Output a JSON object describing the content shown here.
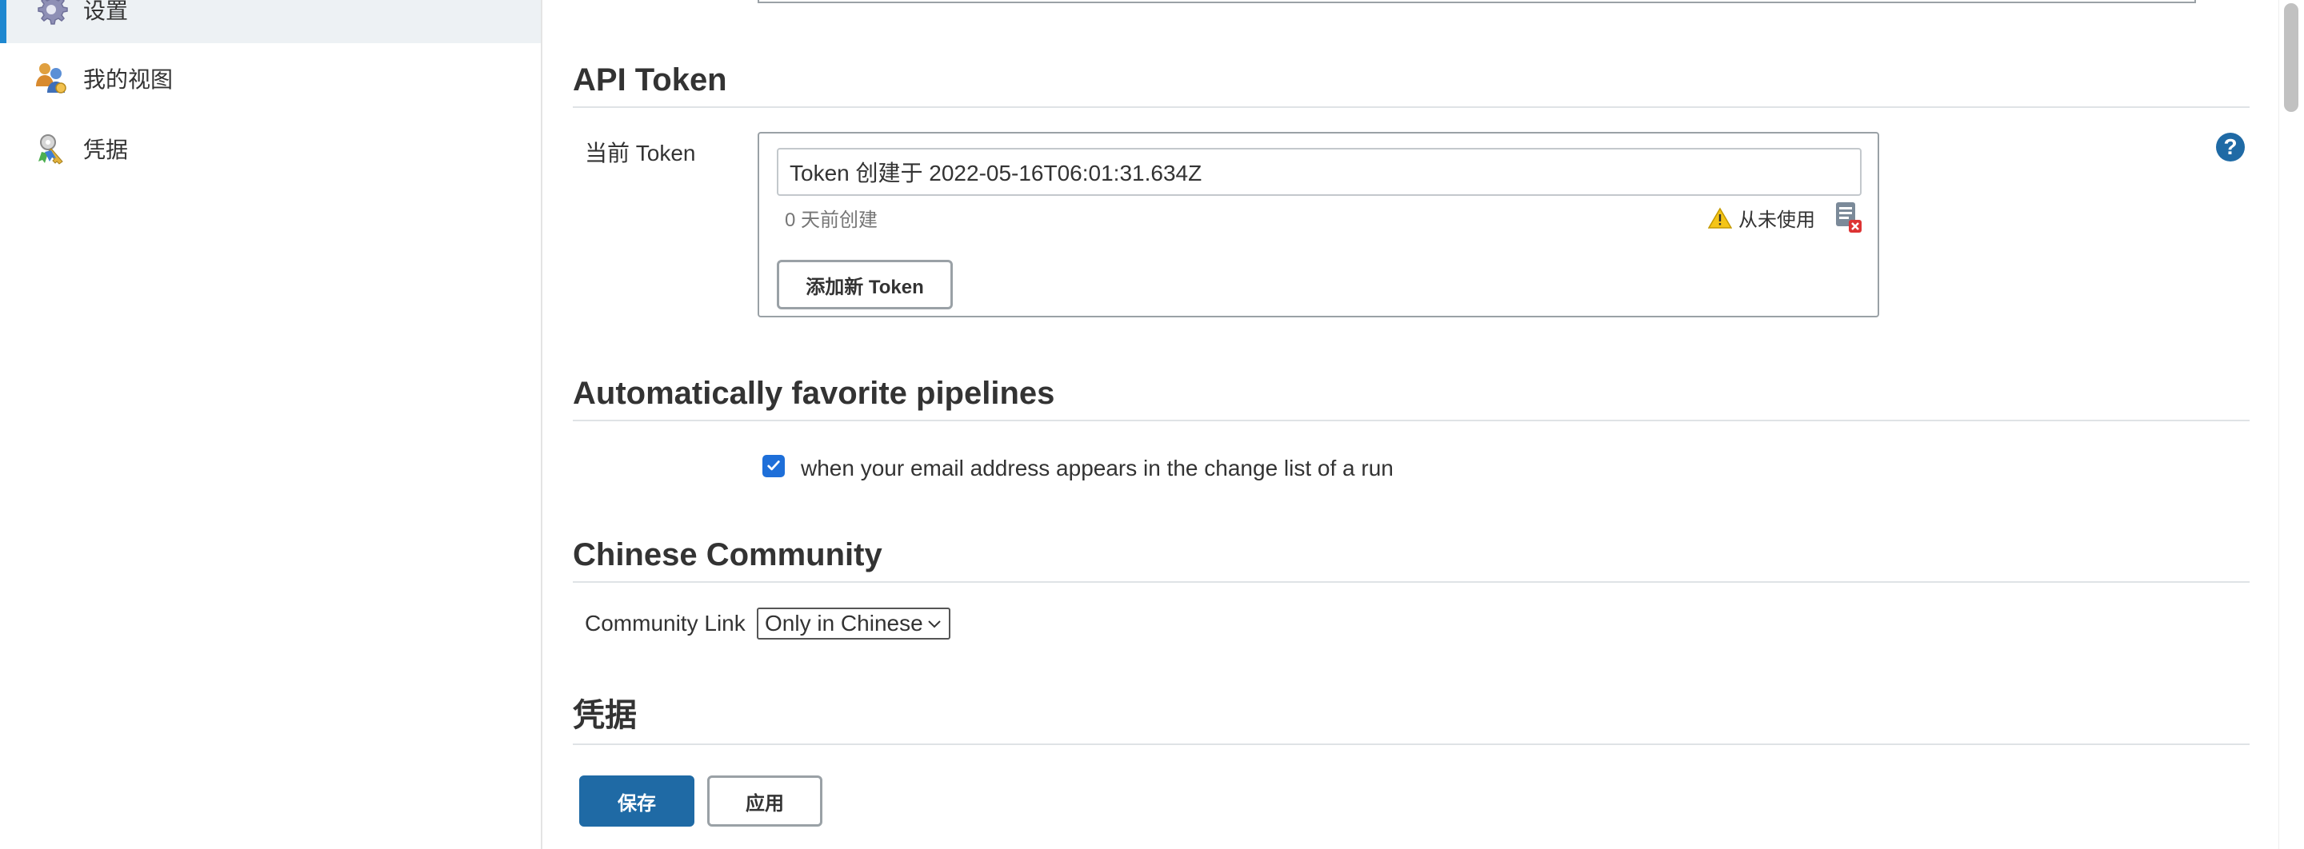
{
  "sidebar": {
    "items": [
      {
        "label": "设置",
        "icon": "gear-icon",
        "active": true
      },
      {
        "label": "我的视图",
        "icon": "people-view-icon",
        "active": false
      },
      {
        "label": "凭据",
        "icon": "credentials-key-icon",
        "active": false
      }
    ]
  },
  "api_token": {
    "title": "API Token",
    "current_label": "当前 Token",
    "token_value": "Token 创建于 2022-05-16T06:01:31.634Z",
    "age_text": "0 天前创建",
    "usage_text": "从未使用",
    "add_button": "添加新 Token"
  },
  "favorites": {
    "title": "Automatically favorite pipelines",
    "checkbox_label": "when your email address appears in the change list of a run",
    "checked": true
  },
  "community": {
    "title": "Chinese Community",
    "link_label": "Community Link",
    "selected_option": "Only in Chinese"
  },
  "credentials": {
    "title": "凭据"
  },
  "actions": {
    "save": "保存",
    "apply": "应用"
  },
  "help": {
    "glyph": "?"
  },
  "colors": {
    "accent": "#1f6aa5",
    "active_bar": "#1e88d0",
    "checkbox": "#1e6fd9"
  }
}
